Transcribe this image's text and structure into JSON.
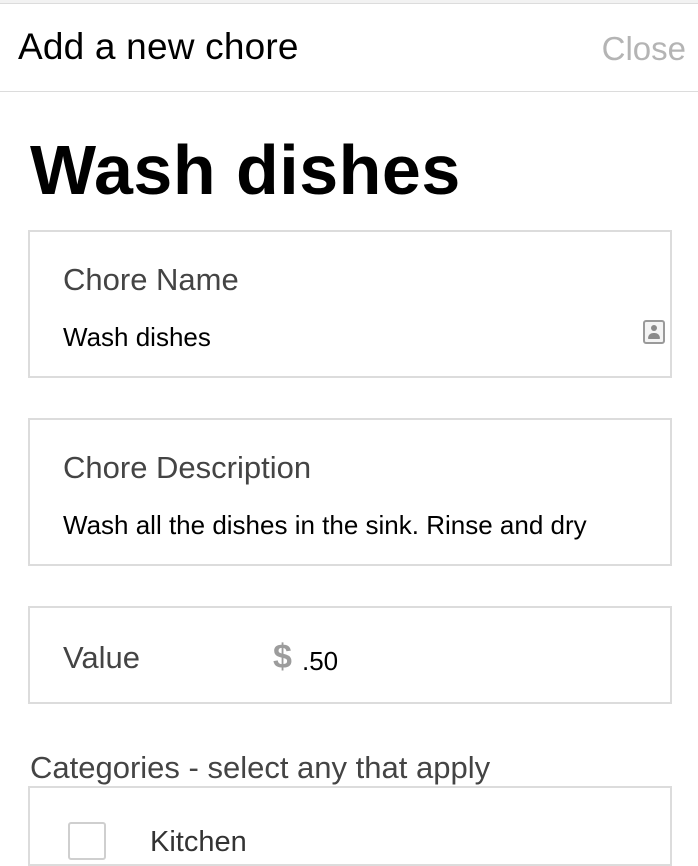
{
  "header": {
    "title": "Add a new chore",
    "close_label": "Close"
  },
  "page_title": "Wash dishes",
  "fields": {
    "chore_name": {
      "label": "Chore Name",
      "value": "Wash dishes"
    },
    "chore_description": {
      "label": "Chore Description",
      "value": "Wash all the dishes in the sink. Rinse and dry"
    },
    "value": {
      "label": "Value",
      "currency_symbol": "$",
      "amount": ".50"
    }
  },
  "categories": {
    "heading": "Categories - select any that apply",
    "items": [
      {
        "label": "Kitchen",
        "checked": false
      }
    ]
  },
  "colors": {
    "border": "#dcdcdc",
    "muted_text": "#b4b4b4",
    "label_text": "#444444"
  },
  "icons": {
    "contact": "contact-card-icon",
    "currency": "dollar-icon",
    "checkbox": "checkbox-icon"
  }
}
